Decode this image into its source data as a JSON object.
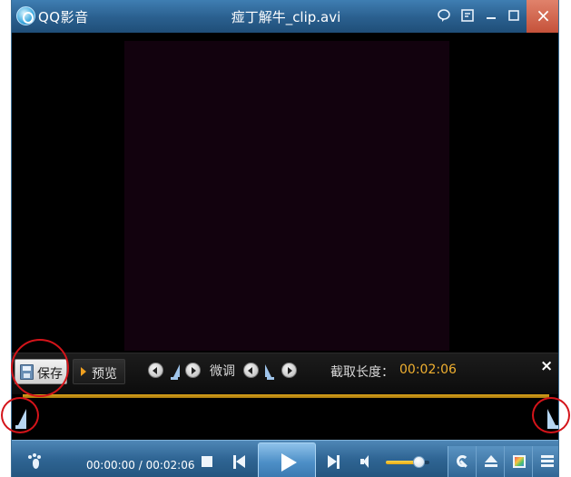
{
  "titlebar": {
    "app_name": "QQ影音",
    "window_title": "痖丁解牛_clip.avi",
    "icons": [
      "skin-bubble-icon",
      "mini-mode-icon",
      "minimize-icon",
      "maximize-icon",
      "close-icon"
    ],
    "close_symbol": "×"
  },
  "clip_toolbar": {
    "save_label": "保存",
    "preview_label": "预览",
    "fine_tune_label": "微调",
    "length_label": "截取长度：",
    "length_value": "00:02:06",
    "close_symbol": "×"
  },
  "controls": {
    "time_display": "00:00:00 / 00:02:06",
    "volume_level": 0.75
  },
  "colors": {
    "titlebar": "#2a5f8e",
    "accent_time": "#f0b030",
    "timeline": "#d9a21a",
    "highlight": "#d4141a"
  }
}
